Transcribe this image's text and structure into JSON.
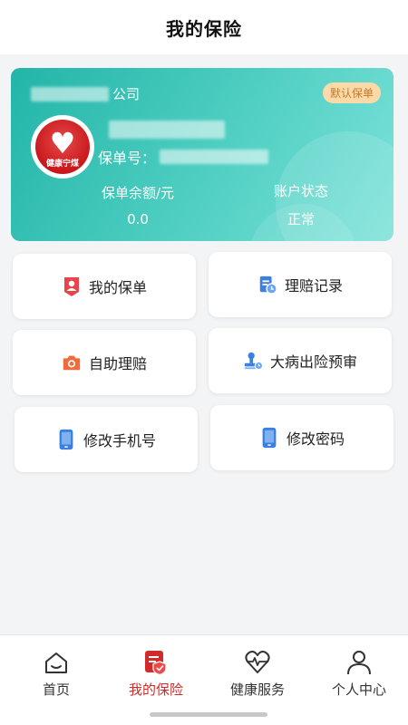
{
  "header": {
    "title": "我的保险"
  },
  "policy_card": {
    "company_suffix": "公司",
    "default_badge": "默认保单",
    "logo_text": "健康宁煤",
    "policy_no_label": "保单号：",
    "balance_label": "保单余额/元",
    "balance_value": "0.0",
    "status_label": "账户状态",
    "status_value": "正常"
  },
  "menu": {
    "items": [
      {
        "label": "我的保单",
        "icon": "user-badge-icon"
      },
      {
        "label": "理赔记录",
        "icon": "record-clock-icon"
      },
      {
        "label": "自助理赔",
        "icon": "camera-icon"
      },
      {
        "label": "大病出险预审",
        "icon": "stamp-clock-icon"
      },
      {
        "label": "修改手机号",
        "icon": "phone-icon"
      },
      {
        "label": "修改密码",
        "icon": "phone-icon"
      }
    ]
  },
  "tabbar": {
    "items": [
      {
        "label": "首页",
        "icon": "home-icon",
        "active": false
      },
      {
        "label": "我的保险",
        "icon": "policy-shield-icon",
        "active": true
      },
      {
        "label": "健康服务",
        "icon": "heartbeat-icon",
        "active": false
      },
      {
        "label": "个人中心",
        "icon": "person-icon",
        "active": false
      }
    ]
  },
  "colors": {
    "card_gradient_start": "#22b5a8",
    "card_gradient_end": "#7ee3da",
    "active_tab": "#d02a2a",
    "badge_bg": "#fbd9a8"
  }
}
